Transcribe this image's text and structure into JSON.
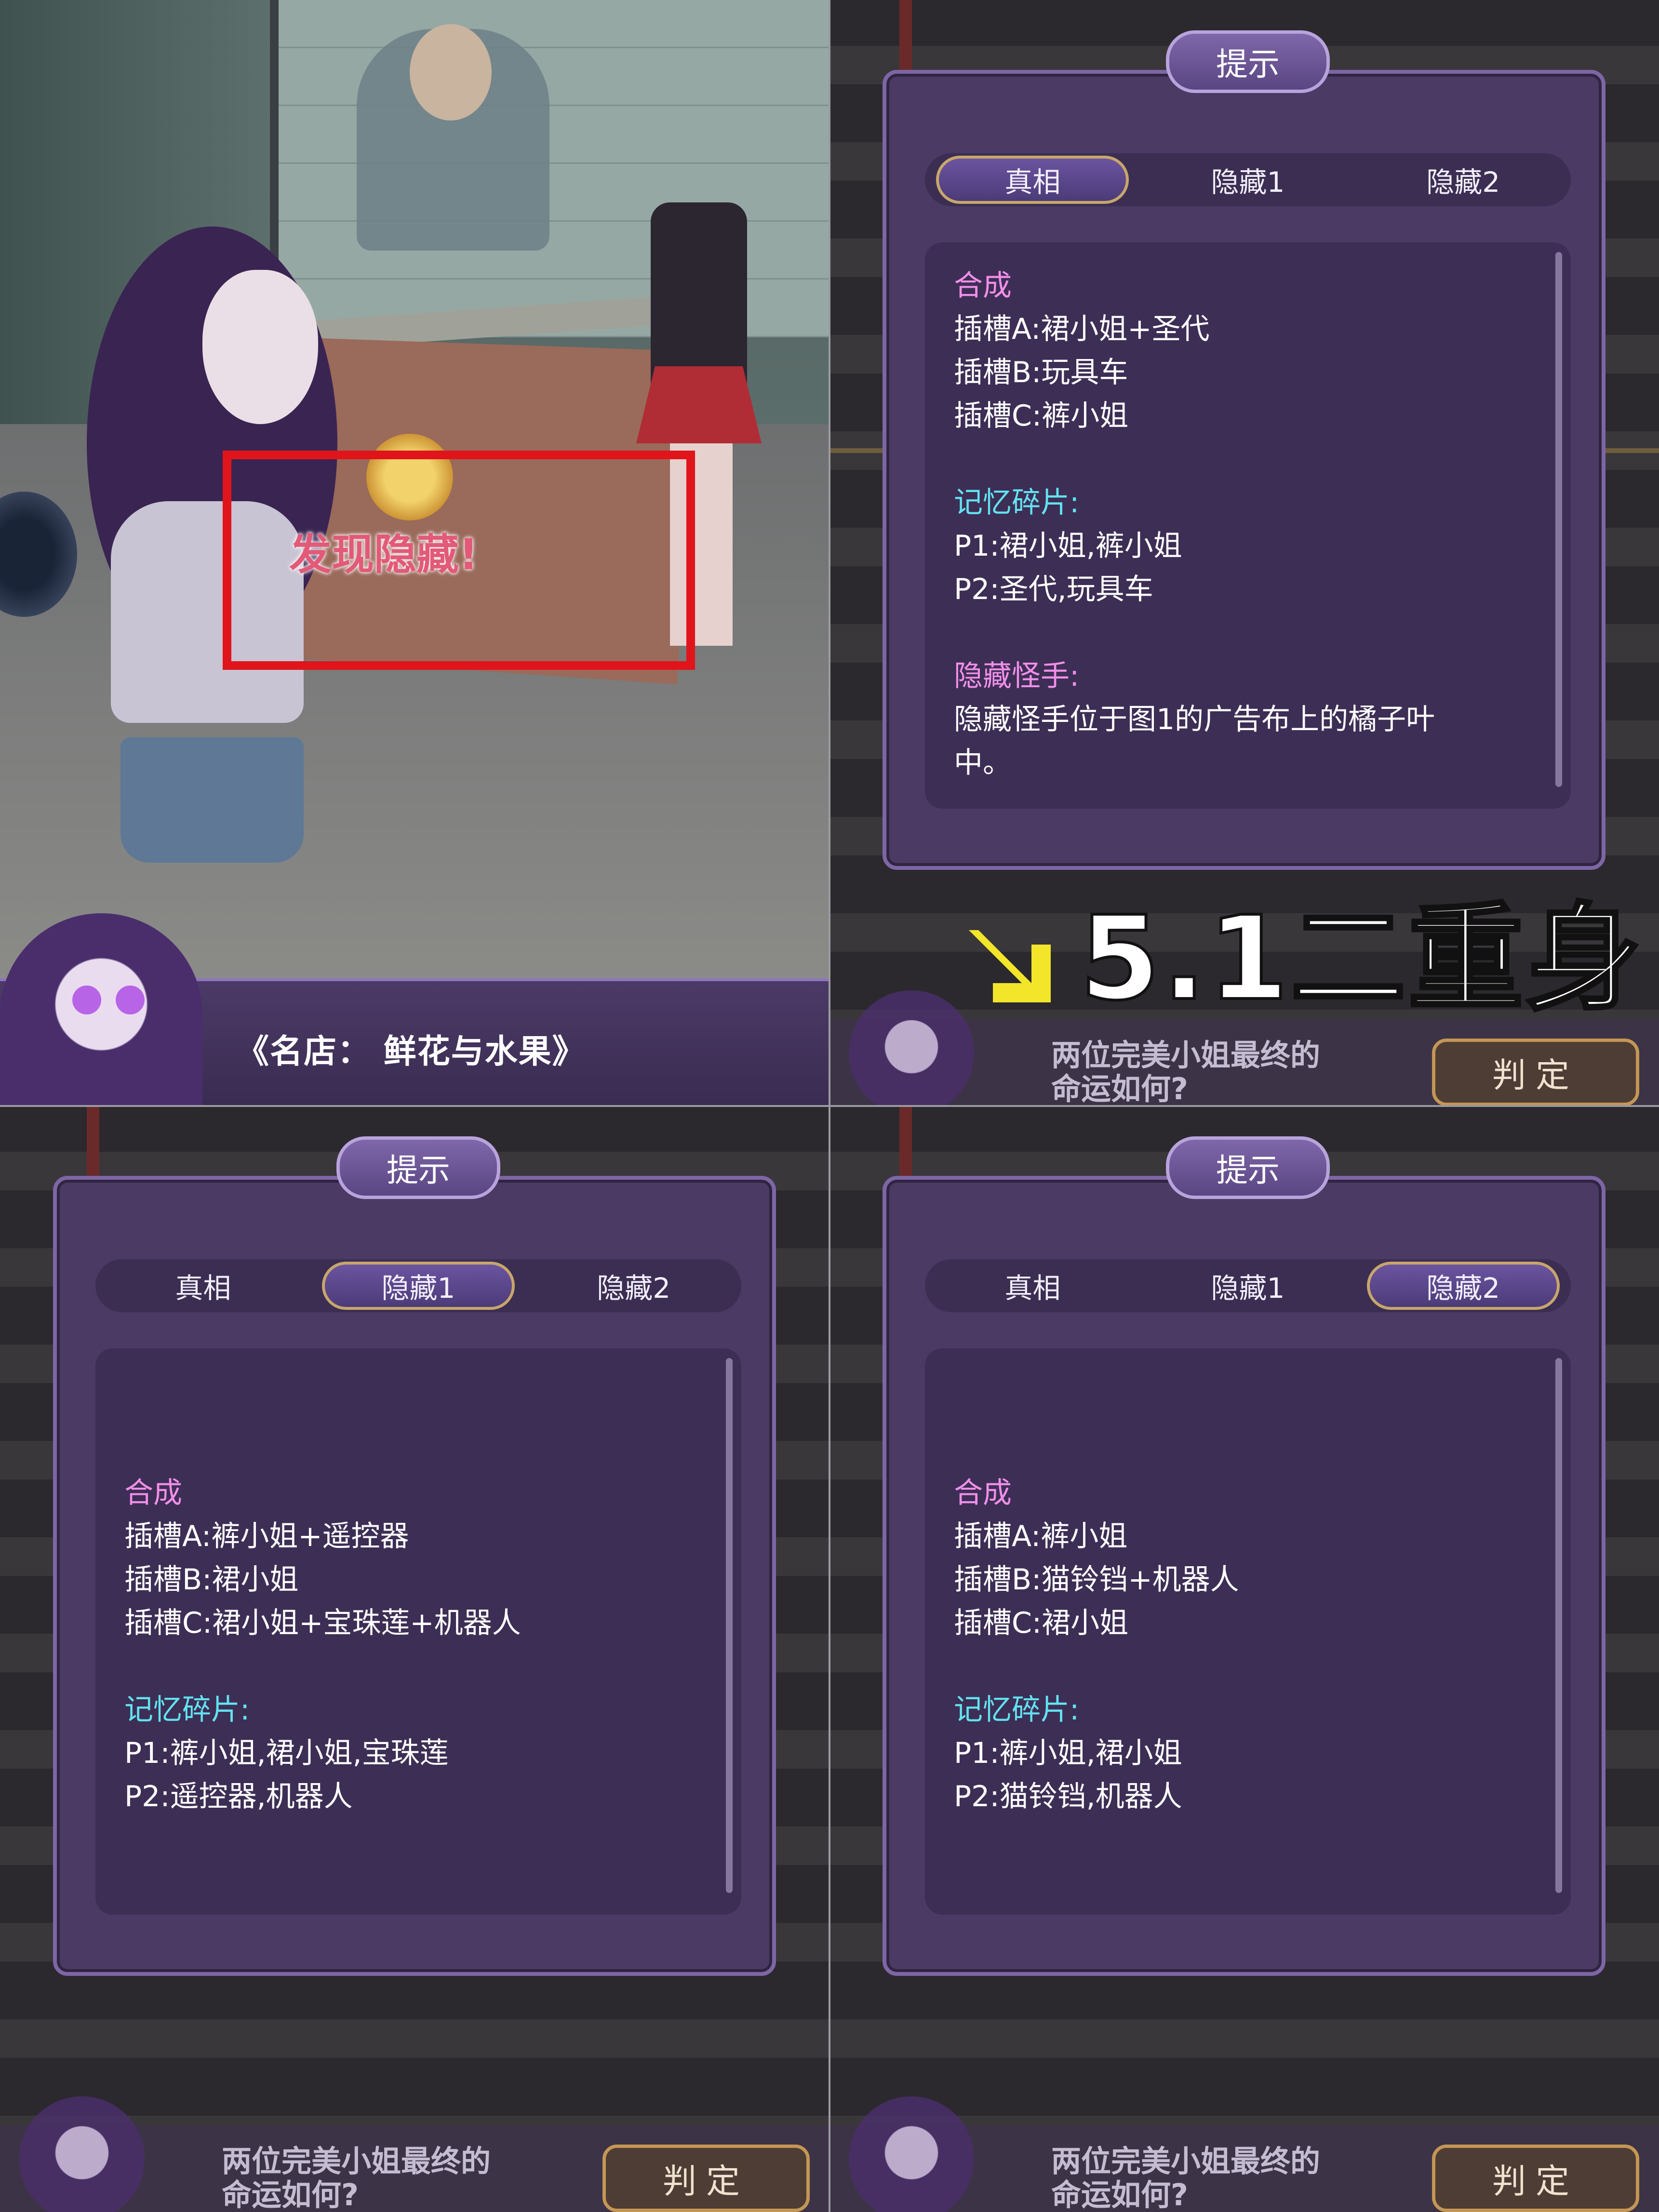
{
  "scene": {
    "found_hidden": "发现隐藏!",
    "dialog_text": "《名店：  鲜花与水果》"
  },
  "overlay": {
    "label": "5.1二重身"
  },
  "hint_panels": [
    {
      "title": "提示",
      "tabs": [
        "真相",
        "隐藏1",
        "隐藏2"
      ],
      "active_tab": "真相",
      "sections": {
        "synthesis_heading": "合成",
        "slots": [
          "插槽A:裙小姐+圣代",
          "插槽B:玩具车",
          "插槽C:裤小姐"
        ],
        "memory_heading": "记忆碎片:",
        "memory": [
          "P1:裙小姐,裤小姐",
          "P2:圣代,玩具车"
        ],
        "hidden_heading": "隐藏怪手:",
        "hidden_text_1": "隐藏怪手位于图1的广告布上的橘子叶",
        "hidden_text_2": "中。"
      },
      "bottom": {
        "question_1": "两位完美小姐最终的",
        "question_2": "命运如何?",
        "judge": "判定"
      }
    },
    {
      "title": "提示",
      "tabs": [
        "真相",
        "隐藏1",
        "隐藏2"
      ],
      "active_tab": "隐藏1",
      "sections": {
        "synthesis_heading": "合成",
        "slots": [
          "插槽A:裤小姐+遥控器",
          "插槽B:裙小姐",
          "插槽C:裙小姐+宝珠莲+机器人"
        ],
        "memory_heading": "记忆碎片:",
        "memory": [
          "P1:裤小姐,裙小姐,宝珠莲",
          "P2:遥控器,机器人"
        ]
      },
      "bottom": {
        "question_1": "两位完美小姐最终的",
        "question_2": "命运如何?",
        "judge": "判定"
      }
    },
    {
      "title": "提示",
      "tabs": [
        "真相",
        "隐藏1",
        "隐藏2"
      ],
      "active_tab": "隐藏2",
      "sections": {
        "synthesis_heading": "合成",
        "slots": [
          "插槽A:裤小姐",
          "插槽B:猫铃铛+机器人",
          "插槽C:裙小姐"
        ],
        "memory_heading": "记忆碎片:",
        "memory": [
          "P1:裤小姐,裙小姐",
          "P2:猫铃铛,机器人"
        ]
      },
      "bottom": {
        "question_1": "两位完美小姐最终的",
        "question_2": "命运如何?",
        "judge": "判定"
      }
    }
  ],
  "colors": {
    "panel": "#4a3a64",
    "heading_pink": "#f08fe8",
    "heading_cyan": "#62e3f0",
    "highlight_box": "#e0151b",
    "arrow": "#f2e52a"
  }
}
